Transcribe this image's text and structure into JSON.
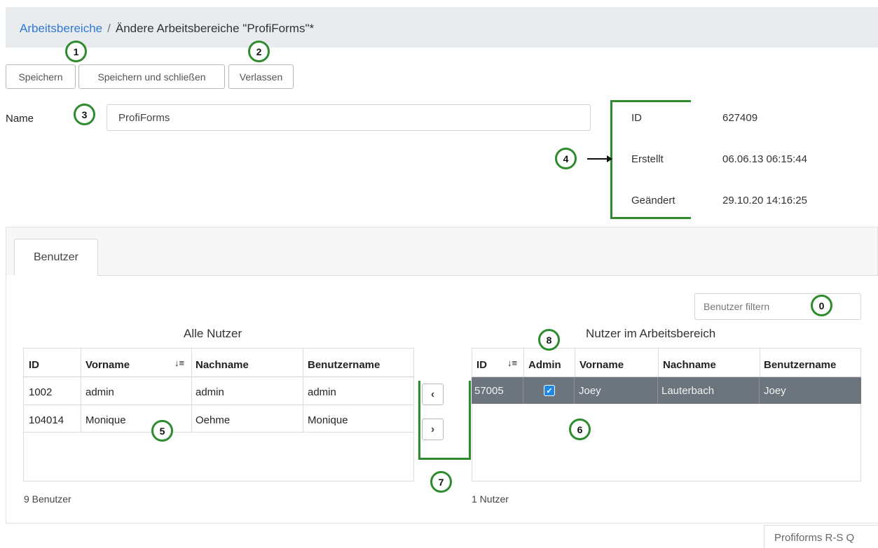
{
  "breadcrumb": {
    "root": "Arbeitsbereiche",
    "separator": "/",
    "current": "Ändere Arbeitsbereiche \"ProfiForms\"*"
  },
  "toolbar": {
    "save": "Speichern",
    "save_close": "Speichern und schließen",
    "leave": "Verlassen"
  },
  "name_field": {
    "label": "Name",
    "value": "ProfiForms"
  },
  "info": {
    "id_label": "ID",
    "id_value": "627409",
    "created_label": "Erstellt",
    "created_value": "06.06.13 06:15:44",
    "changed_label": "Geändert",
    "changed_value": "29.10.20 14:16:25"
  },
  "tabs": {
    "users": "Benutzer"
  },
  "filter": {
    "placeholder": "Benutzer filtern"
  },
  "all_users": {
    "title": "Alle Nutzer",
    "headers": {
      "id": "ID",
      "firstname": "Vorname",
      "lastname": "Nachname",
      "username": "Benutzername"
    },
    "rows": [
      {
        "id": "1002",
        "firstname": "admin",
        "lastname": "admin",
        "username": "admin"
      },
      {
        "id": "104014",
        "firstname": "Monique",
        "lastname": "Oehme",
        "username": "Monique"
      }
    ],
    "count": "9 Benutzer"
  },
  "workspace_users": {
    "title": "Nutzer im Arbeitsbereich",
    "headers": {
      "id": "ID",
      "admin": "Admin",
      "firstname": "Vorname",
      "lastname": "Nachname",
      "username": "Benutzername"
    },
    "rows": [
      {
        "id": "57005",
        "admin": true,
        "firstname": "Joey",
        "lastname": "Lauterbach",
        "username": "Joey"
      }
    ],
    "count": "1 Nutzer"
  },
  "transfer": {
    "left": "‹",
    "right": "›"
  },
  "sort_icon": "sort-ascending-icon",
  "markers": {
    "m0": "0",
    "m1": "1",
    "m2": "2",
    "m3": "3",
    "m4": "4",
    "m5": "5",
    "m6": "6",
    "m7": "7",
    "m8": "8"
  },
  "footer": {
    "text": "Profiforms R-S Q"
  },
  "colors": {
    "link": "#2e7ad6",
    "marker": "#2e8b2e",
    "selected_row": "#6c757d",
    "checkbox": "#1e88e5"
  }
}
